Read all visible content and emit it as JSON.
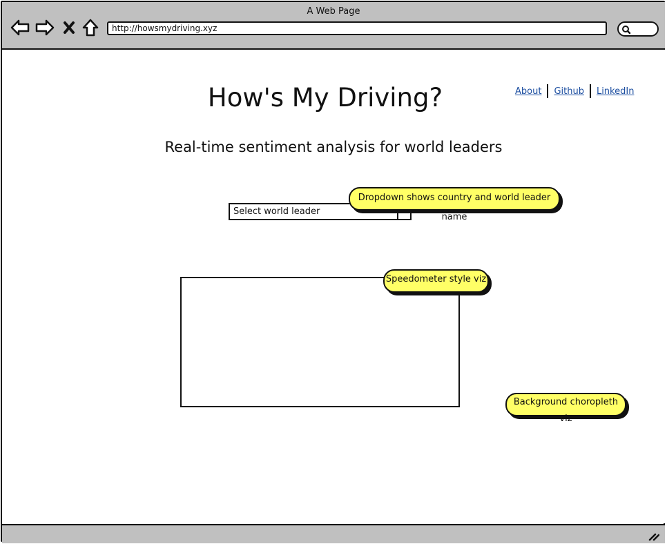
{
  "window": {
    "title": "A Web Page"
  },
  "browser": {
    "url": "http://howsmydriving.xyz"
  },
  "page": {
    "title": "How's My Driving?",
    "subtitle": "Real-time sentiment analysis for world leaders"
  },
  "nav_links": [
    "About",
    "Github",
    "LinkedIn"
  ],
  "selector": {
    "placeholder": "Select world leader"
  },
  "notes": {
    "dropdown": "Dropdown shows country and world leader name",
    "speedometer": "Speedometer style viz",
    "choropleth": "Background choropleth viz"
  },
  "colors": {
    "note": "#ffff66",
    "chrome": "#c0c0c0",
    "link": "#1c4ea0"
  },
  "icons": [
    "back-arrow-icon",
    "forward-arrow-icon",
    "close-icon",
    "home-icon",
    "search-icon",
    "resize-grip-icon"
  ]
}
